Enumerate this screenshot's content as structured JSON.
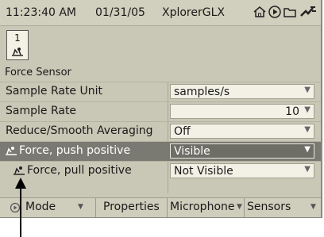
{
  "status_bar": {
    "time": "11:23:40 AM",
    "date": "01/31/05",
    "app_name": "XplorerGLX",
    "icons": [
      "home-icon",
      "play-record-icon",
      "folder-icon",
      "power-plug-icon"
    ]
  },
  "sensor": {
    "port_number": "1",
    "icon": "force-sensor-icon",
    "name": "Force Sensor"
  },
  "properties": [
    {
      "label": "Sample Rate Unit",
      "value": "samples/s",
      "align": "left"
    },
    {
      "label": "Sample Rate",
      "value": "10",
      "align": "right"
    },
    {
      "label": "Reduce/Smooth Averaging",
      "value": "Off",
      "align": "left"
    },
    {
      "label": "Force, push positive",
      "value": "Visible",
      "align": "left",
      "selected": true,
      "icon": "force-channel-icon"
    },
    {
      "label": "Force, pull positive",
      "value": "Not Visible",
      "align": "left",
      "icon": "force-channel-icon"
    }
  ],
  "softkeys": [
    {
      "label": "Mode",
      "has_dropdown": true
    },
    {
      "label": "Properties",
      "has_dropdown": false
    },
    {
      "label": "Microphone",
      "has_dropdown": true
    },
    {
      "label": "Sensors",
      "has_dropdown": true
    }
  ],
  "colors": {
    "background": "#c9c7b6",
    "selected_row": "#7a7a72",
    "value_box": "#f3f1e6"
  }
}
